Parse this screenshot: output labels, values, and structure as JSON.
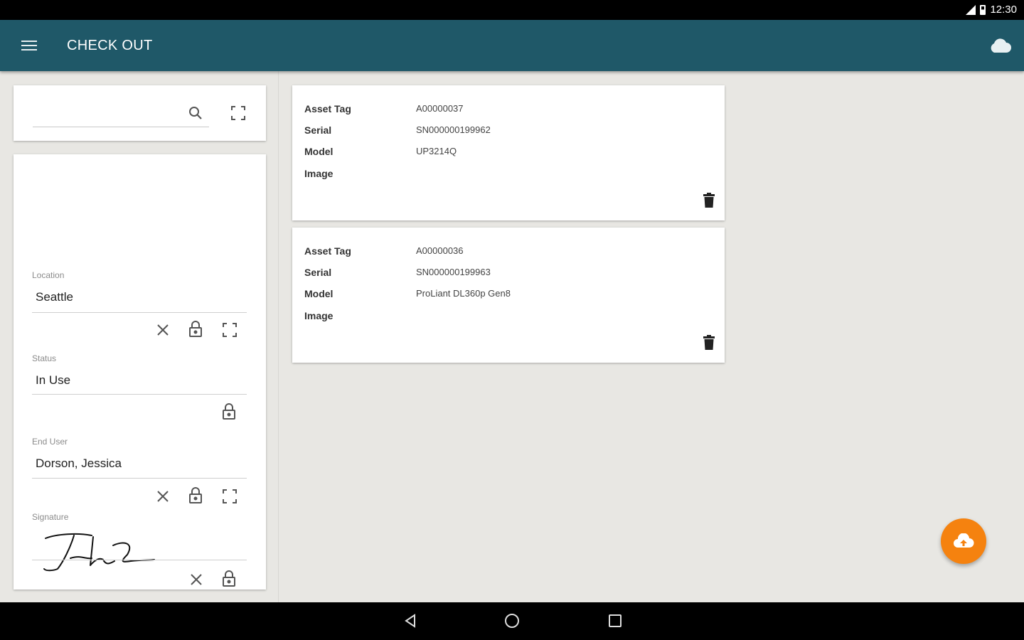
{
  "status_bar": {
    "time": "12:30"
  },
  "app_bar": {
    "title": "CHECK OUT",
    "accent": "#1f5868",
    "fab_color": "#f5820f"
  },
  "search": {
    "value": "",
    "placeholder": ""
  },
  "form": {
    "location": {
      "label": "Location",
      "value": "Seattle"
    },
    "status": {
      "label": "Status",
      "value": "In Use"
    },
    "end_user": {
      "label": "End User",
      "value": "Dorson, Jessica"
    },
    "signature": {
      "label": "Signature"
    }
  },
  "assets": [
    {
      "tag_label": "Asset Tag",
      "tag": "A00000037",
      "serial_label": "Serial",
      "serial": "SN000000199962",
      "model_label": "Model",
      "model": "UP3214Q",
      "image_label": "Image"
    },
    {
      "tag_label": "Asset Tag",
      "tag": "A00000036",
      "serial_label": "Serial",
      "serial": "SN000000199963",
      "model_label": "Model",
      "model": "ProLiant DL360p Gen8",
      "image_label": "Image"
    }
  ]
}
